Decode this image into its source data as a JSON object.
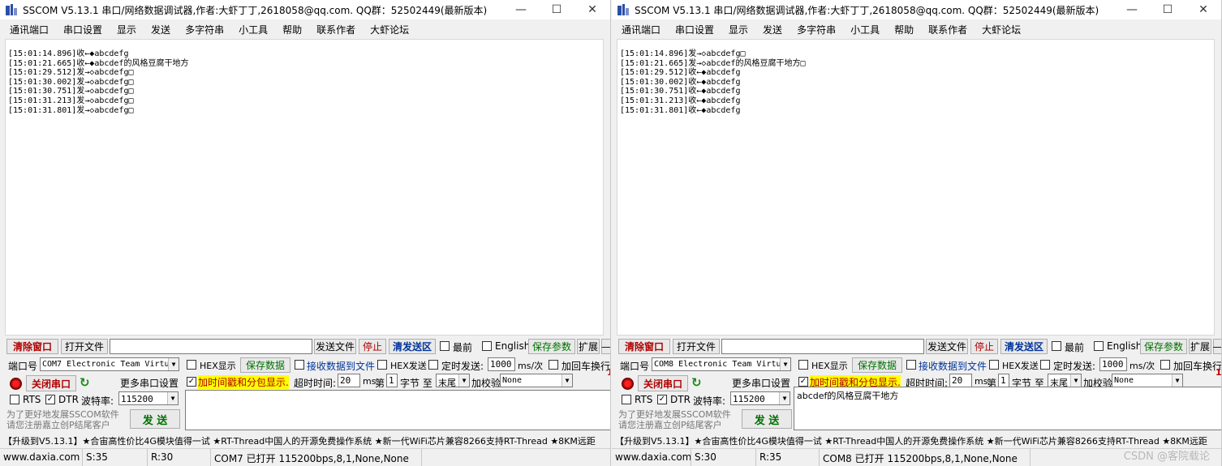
{
  "windows": [
    {
      "title": "SSCOM V5.13.1 串口/网络数据调试器,作者:大虾丁丁,2618058@qq.com. QQ群：52502449(最新版本)",
      "menu": [
        "通讯端口",
        "串口设置",
        "显示",
        "发送",
        "多字符串",
        "小工具",
        "帮助",
        "联系作者",
        "大虾论坛"
      ],
      "receive_lines": [
        "[15:01:14.896]收←◆abcdefg",
        "[15:01:21.665]收←◆abcdef的风格豆腐干地方",
        "[15:01:29.512]发→◇abcdefg□",
        "[15:01:30.002]发→◇abcdefg□",
        "[15:01:30.751]发→◇abcdefg□",
        "[15:01:31.213]发→◇abcdefg□",
        "[15:01:31.801]发→◇abcdefg□"
      ],
      "toolbar": {
        "clear_window": "清除窗口",
        "open_file": "打开文件",
        "send_file": "发送文件",
        "stop": "停止",
        "clear_send": "清发送区",
        "latest": "最前",
        "english": "English",
        "save_params": "保存参数",
        "expand": "扩展",
        "dash": "—"
      },
      "port": {
        "label": "端口号",
        "value": "COM7 Electronic Team Virtu",
        "hex_display": "HEX显示",
        "save_data": "保存数据",
        "recv_to_file": "接收数据到文件",
        "hex_send": "HEX发送",
        "timed_send": "定时发送:",
        "interval": "1000",
        "interval_unit": "ms/次",
        "add_crlf": "加回车换行",
        "close_port": "关闭串口",
        "more_settings": "更多串口设置",
        "timestamp": "加时间戳和分包显示.",
        "timeout_label": "超时时间:",
        "timeout": "20",
        "ms": "ms",
        "nth": "第",
        "byte_num": "1",
        "byte_to": "字节 至",
        "tail": "末尾",
        "checksum_label": "加校验",
        "checksum": "None",
        "rts": "RTS",
        "dtr": "DTR",
        "baud_label": "波特率:",
        "baud": "115200",
        "hint1": "为了更好地发展SSCOM软件",
        "hint2": "请您注册嘉立创P结尾客户",
        "send": "发 送",
        "send_text": "",
        "red_mark": "1"
      },
      "promo": "【升级到V5.13.1】★合宙高性价比4G模块值得一试 ★RT-Thread中国人的开源免费操作系统 ★新一代WiFi芯片兼容8266支持RT-Thread ★8KM远距",
      "status": [
        "www.daxia.com",
        "S:35",
        "R:30",
        "COM7 已打开  115200bps,8,1,None,None"
      ]
    },
    {
      "title": "SSCOM V5.13.1 串口/网络数据调试器,作者:大虾丁丁,2618058@qq.com. QQ群：52502449(最新版本)",
      "menu": [
        "通讯端口",
        "串口设置",
        "显示",
        "发送",
        "多字符串",
        "小工具",
        "帮助",
        "联系作者",
        "大虾论坛"
      ],
      "receive_lines": [
        "[15:01:14.896]发→◇abcdefg□",
        "[15:01:21.665]发→◇abcdef的风格豆腐干地方□",
        "[15:01:29.512]收←◆abcdefg",
        "[15:01:30.002]收←◆abcdefg",
        "[15:01:30.751]收←◆abcdefg",
        "[15:01:31.213]收←◆abcdefg",
        "[15:01:31.801]收←◆abcdefg"
      ],
      "toolbar": {
        "clear_window": "清除窗口",
        "open_file": "打开文件",
        "send_file": "发送文件",
        "stop": "停止",
        "clear_send": "清发送区",
        "latest": "最前",
        "english": "English",
        "save_params": "保存参数",
        "expand": "扩展",
        "dash": "—"
      },
      "port": {
        "label": "端口号",
        "value": "COM8 Electronic Team Virtu",
        "hex_display": "HEX显示",
        "save_data": "保存数据",
        "recv_to_file": "接收数据到文件",
        "hex_send": "HEX发送",
        "timed_send": "定时发送:",
        "interval": "1000",
        "interval_unit": "ms/次",
        "add_crlf": "加回车换行",
        "close_port": "关闭串口",
        "more_settings": "更多串口设置",
        "timestamp": "加时间戳和分包显示.",
        "timeout_label": "超时时间:",
        "timeout": "20",
        "ms": "ms",
        "nth": "第",
        "byte_num": "1",
        "byte_to": "字节 至",
        "tail": "末尾",
        "checksum_label": "加校验",
        "checksum": "None",
        "rts": "RTS",
        "dtr": "DTR",
        "baud_label": "波特率:",
        "baud": "115200",
        "hint1": "为了更好地发展SSCOM软件",
        "hint2": "请您注册嘉立创P结尾客户",
        "send": "发 送",
        "send_text": "abcdef的风格豆腐干地方",
        "red_mark": "1"
      },
      "promo": "【升级到V5.13.1】★合宙高性价比4G模块值得一试 ★RT-Thread中国人的开源免费操作系统 ★新一代WiFi芯片兼容8266支持RT-Thread ★8KM远距",
      "status": [
        "www.daxia.com",
        "S:30",
        "R:35",
        "COM8 已打开  115200bps,8,1,None,None"
      ]
    }
  ],
  "watermark": "CSDN @客院载论",
  "icons": {
    "minimize": "—",
    "maximize": "☐",
    "close": "✕",
    "refresh": "↻",
    "dropdown": "▼",
    "check": "✓"
  }
}
